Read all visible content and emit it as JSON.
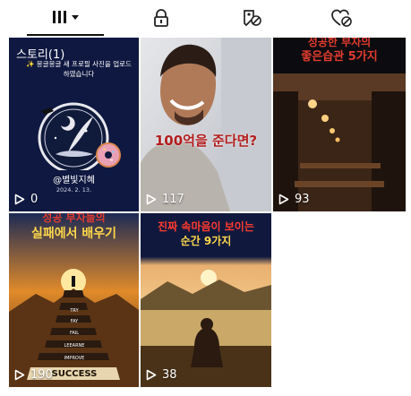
{
  "tabs": [
    {
      "name": "grid",
      "icon": "grid-icon"
    },
    {
      "name": "lock",
      "icon": "lock-icon"
    },
    {
      "name": "tagged",
      "icon": "tag-slash-icon"
    },
    {
      "name": "liked",
      "icon": "heart-slash-icon"
    }
  ],
  "posts": [
    {
      "story_label": "스토리(1)",
      "subtitle": "✨ 몽글몽글 새 프로필 사진을 업로드하였습니다",
      "handle": "@별빛지혜",
      "date": "2024. 2. 13.",
      "count": "0"
    },
    {
      "headline": "100억을 준다면?",
      "count": "117"
    },
    {
      "head1": "성공한 부자의",
      "head2": "좋은습관 5가지",
      "count": "93"
    },
    {
      "head1": "성공 부자들의",
      "head2": "실패에서 배우기",
      "stairs": [
        "TRY",
        "FAY",
        "FAIL",
        "LEEARNE",
        "IMPROVE",
        "SUCCESS"
      ],
      "count": "190"
    },
    {
      "head1": "진짜 속마음이 보이는",
      "head2": "순간 9가지",
      "count": "38"
    }
  ],
  "colors": {
    "active_tab_underline": "#111111",
    "headline_red": "#b21d1d",
    "title_yellow": "#ffd84a"
  }
}
